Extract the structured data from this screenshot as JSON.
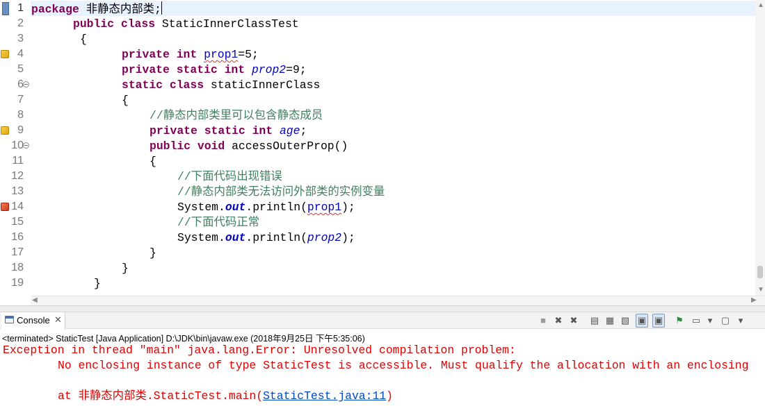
{
  "editor": {
    "current_line": 1,
    "lines": [
      {
        "n": "1",
        "tokens": [
          {
            "t": "package",
            "c": "kw"
          },
          {
            "t": " 非静态内部类;"
          },
          {
            "t": "",
            "c": "caret"
          }
        ],
        "indent": 0
      },
      {
        "n": "2",
        "tokens": [
          {
            "t": "public",
            "c": "kw"
          },
          {
            "t": " "
          },
          {
            "t": "class",
            "c": "kw"
          },
          {
            "t": " StaticInnerClassTest"
          }
        ],
        "indent": 60
      },
      {
        "n": "3",
        "tokens": [
          {
            "t": "{"
          }
        ],
        "indent": 70
      },
      {
        "n": "4",
        "marker": "warn",
        "tokens": [
          {
            "t": "private",
            "c": "kw"
          },
          {
            "t": " "
          },
          {
            "t": "int",
            "c": "kw"
          },
          {
            "t": " "
          },
          {
            "t": "prop1",
            "c": "fld sq"
          },
          {
            "t": "=5;"
          }
        ],
        "indent": 130
      },
      {
        "n": "5",
        "tokens": [
          {
            "t": "private",
            "c": "kw"
          },
          {
            "t": " "
          },
          {
            "t": "static",
            "c": "kw"
          },
          {
            "t": " "
          },
          {
            "t": "int",
            "c": "kw"
          },
          {
            "t": " "
          },
          {
            "t": "prop2",
            "c": "sfld"
          },
          {
            "t": "=9;"
          }
        ],
        "indent": 130
      },
      {
        "n": "6",
        "fold": true,
        "tokens": [
          {
            "t": "static",
            "c": "kw"
          },
          {
            "t": " "
          },
          {
            "t": "class",
            "c": "kw"
          },
          {
            "t": " staticInnerClass"
          }
        ],
        "indent": 130
      },
      {
        "n": "7",
        "tokens": [
          {
            "t": "{"
          }
        ],
        "indent": 130
      },
      {
        "n": "8",
        "tokens": [
          {
            "t": "//静态内部类里可以包含静态成员",
            "c": "cmt"
          }
        ],
        "indent": 170
      },
      {
        "n": "9",
        "marker": "warn",
        "tokens": [
          {
            "t": "private",
            "c": "kw"
          },
          {
            "t": " "
          },
          {
            "t": "static",
            "c": "kw"
          },
          {
            "t": " "
          },
          {
            "t": "int",
            "c": "kw"
          },
          {
            "t": " "
          },
          {
            "t": "age",
            "c": "sfld"
          },
          {
            "t": ";"
          }
        ],
        "indent": 170
      },
      {
        "n": "10",
        "fold": true,
        "tokens": [
          {
            "t": "public",
            "c": "kw"
          },
          {
            "t": " "
          },
          {
            "t": "void",
            "c": "kw"
          },
          {
            "t": " accessOuterProp()"
          }
        ],
        "indent": 170
      },
      {
        "n": "11",
        "tokens": [
          {
            "t": "{"
          }
        ],
        "indent": 170
      },
      {
        "n": "12",
        "tokens": [
          {
            "t": "//下面代码出现错误",
            "c": "cmt"
          }
        ],
        "indent": 210
      },
      {
        "n": "13",
        "tokens": [
          {
            "t": "//静态内部类无法访问外部类的实例变量",
            "c": "cmt"
          }
        ],
        "indent": 210
      },
      {
        "n": "14",
        "marker": "err",
        "tokens": [
          {
            "t": "System."
          },
          {
            "t": "out",
            "c": "sout"
          },
          {
            "t": ".println("
          },
          {
            "t": "prop1",
            "c": "fld sq"
          },
          {
            "t": ");"
          }
        ],
        "indent": 210
      },
      {
        "n": "15",
        "tokens": [
          {
            "t": "//下面代码正常",
            "c": "cmt"
          }
        ],
        "indent": 210
      },
      {
        "n": "16",
        "tokens": [
          {
            "t": "System."
          },
          {
            "t": "out",
            "c": "sout"
          },
          {
            "t": ".println("
          },
          {
            "t": "prop2",
            "c": "sfld"
          },
          {
            "t": ");"
          }
        ],
        "indent": 210
      },
      {
        "n": "17",
        "tokens": [
          {
            "t": "}"
          }
        ],
        "indent": 170
      },
      {
        "n": "18",
        "tokens": [
          {
            "t": "}"
          }
        ],
        "indent": 130
      },
      {
        "n": "19",
        "tokens": [
          {
            "t": "}"
          }
        ],
        "indent": 90
      }
    ]
  },
  "console": {
    "tab_label": "Console",
    "close_glyph": "✕",
    "status": "<terminated> StaticTest [Java Application] D:\\JDK\\bin\\javaw.exe (2018年9月25日 下午5:35:06)",
    "output": {
      "line1": "Exception in thread \"main\" java.lang.Error: Unresolved compilation problem: ",
      "line2": "No enclosing instance of type StaticTest is accessible. Must qualify the allocation with an enclosing",
      "line3_prefix": "at 非静态内部类.StaticTest.main(",
      "line3_link": "StaticTest.java:11",
      "line3_suffix": ")"
    },
    "toolbar": [
      {
        "name": "terminate-icon",
        "glyph": "■"
      },
      {
        "name": "remove-launch-icon",
        "glyph": "✖"
      },
      {
        "name": "remove-all-launches-icon",
        "glyph": "✖"
      },
      {
        "name": "clear-console-icon",
        "glyph": "▤"
      },
      {
        "name": "scroll-lock-icon",
        "glyph": "▦"
      },
      {
        "name": "word-wrap-icon",
        "glyph": "▧"
      },
      {
        "name": "show-on-stdout-icon",
        "glyph": "▣",
        "pressed": true
      },
      {
        "name": "show-on-stderr-icon",
        "glyph": "▣",
        "pressed": true
      },
      {
        "name": "pin-console-icon",
        "glyph": "⚑"
      },
      {
        "name": "display-console-icon",
        "glyph": "▭"
      },
      {
        "name": "display-console-dropdown-icon",
        "glyph": "▾"
      },
      {
        "name": "open-console-icon",
        "glyph": "▢"
      },
      {
        "name": "open-console-dropdown-icon",
        "glyph": "▾"
      }
    ],
    "colors": {
      "error_text": "#e00000",
      "link": "#0046c8"
    }
  }
}
